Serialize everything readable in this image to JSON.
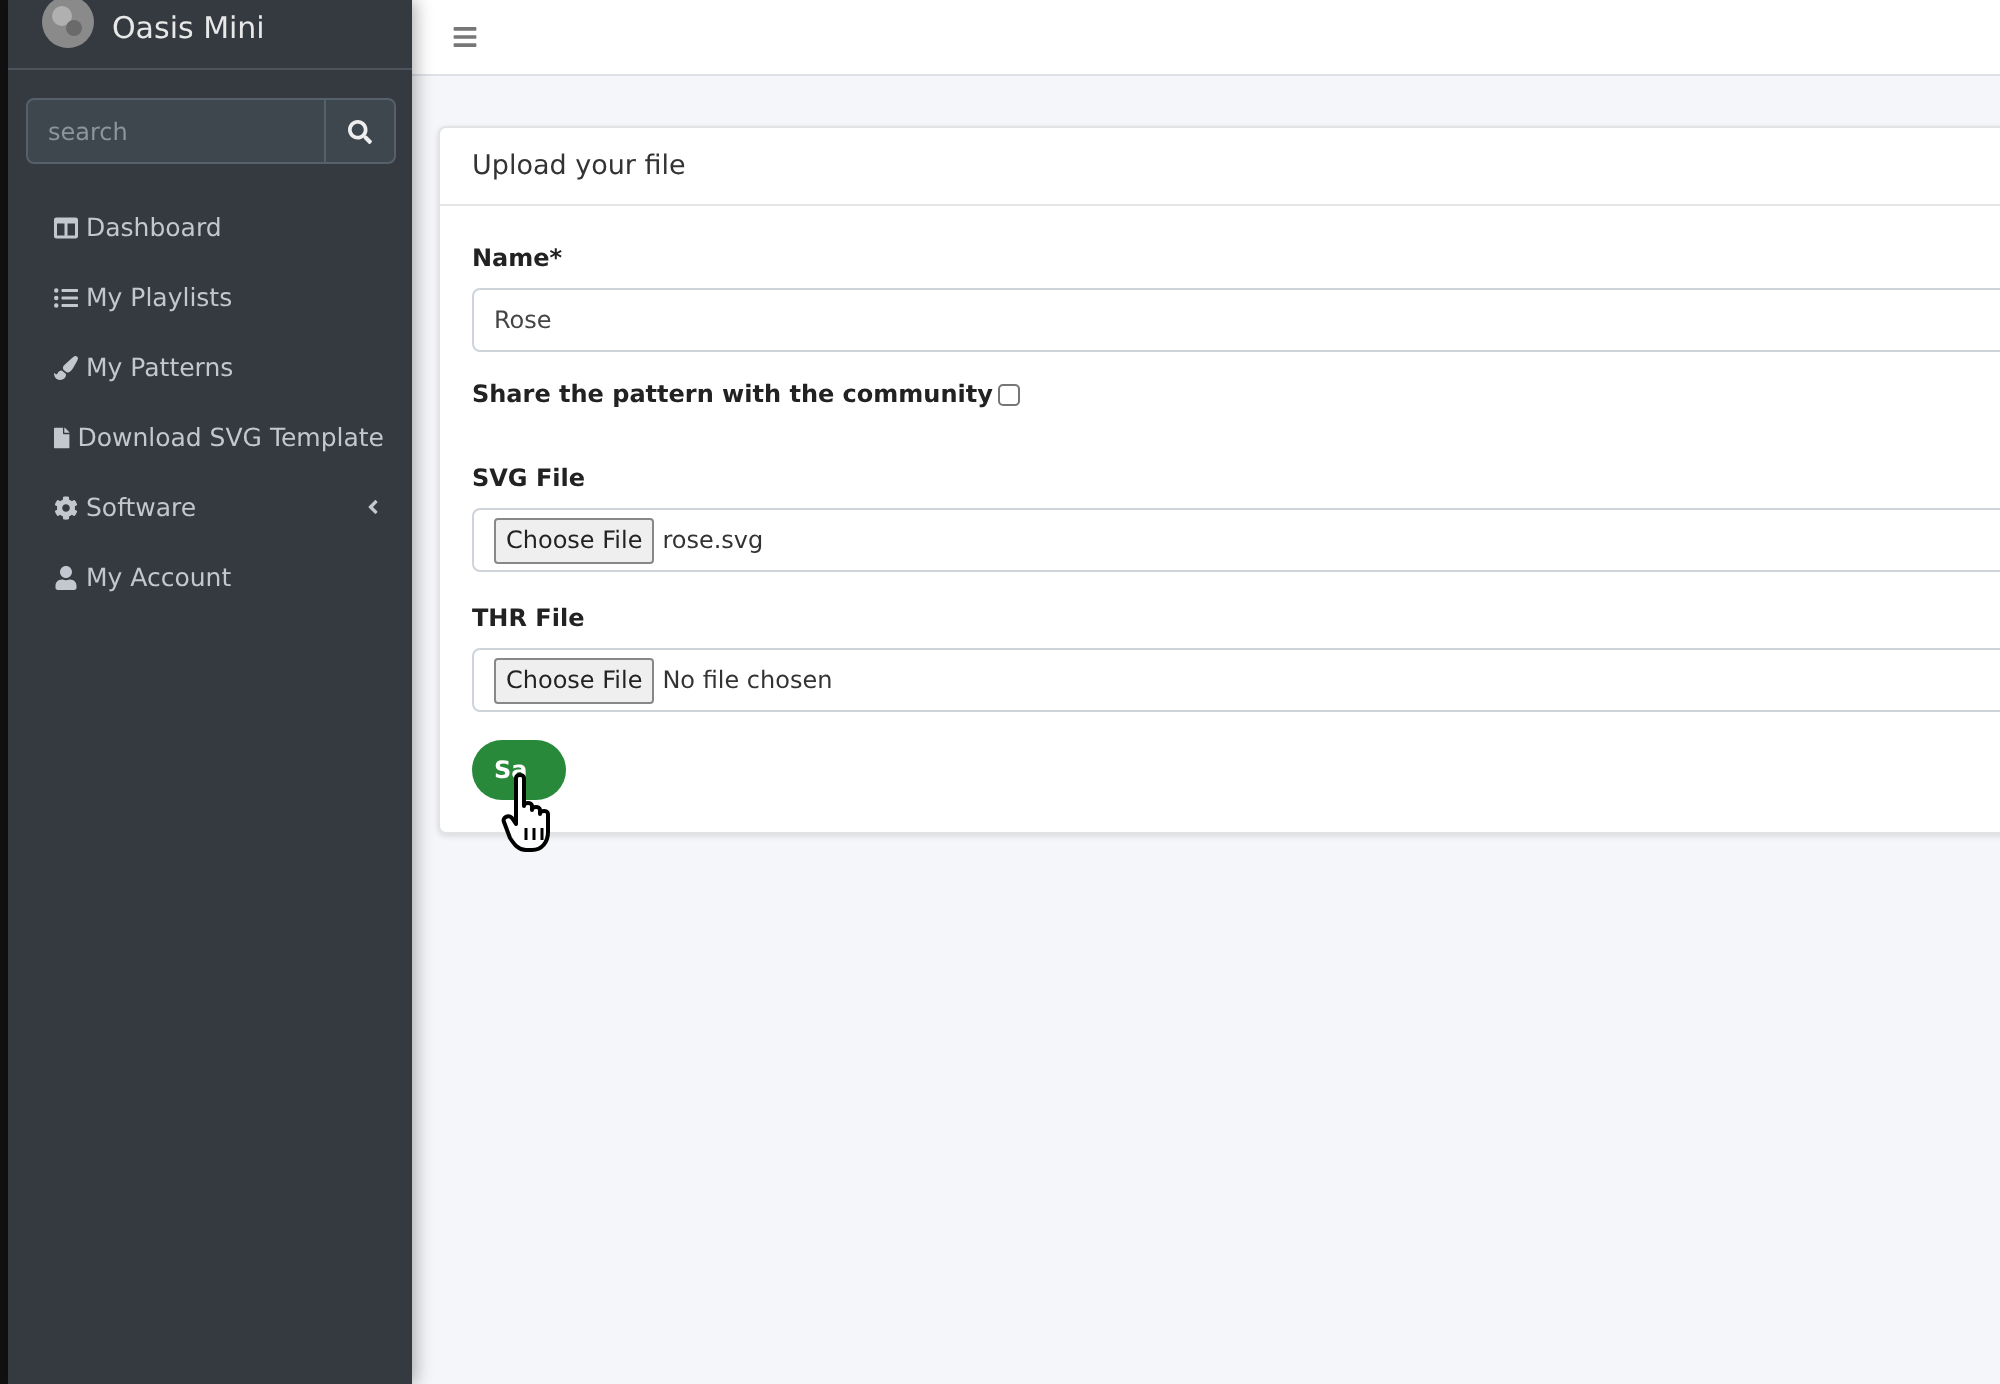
{
  "sidebar": {
    "brand": "Oasis Mini",
    "search": {
      "placeholder": "search"
    },
    "items": [
      {
        "kind": "dashboard",
        "label": "Dashboard",
        "expandable": false
      },
      {
        "kind": "list",
        "label": "My Playlists",
        "expandable": false
      },
      {
        "kind": "brush",
        "label": "My Patterns",
        "expandable": false
      },
      {
        "kind": "file",
        "label": "Download SVG Template",
        "expandable": false
      },
      {
        "kind": "gear",
        "label": "Software",
        "expandable": true
      },
      {
        "kind": "user",
        "label": "My Account",
        "expandable": false
      }
    ]
  },
  "card": {
    "title": "Upload your file",
    "name_field": {
      "label": "Name*",
      "value": "Rose"
    },
    "share": {
      "label": "Share the pattern with the community",
      "checked": false
    },
    "files": [
      {
        "label": "SVG File",
        "button": "Choose File",
        "status": "rose.svg"
      },
      {
        "label": "THR File",
        "button": "Choose File",
        "status": "No file chosen"
      }
    ],
    "submit": "Sa"
  }
}
